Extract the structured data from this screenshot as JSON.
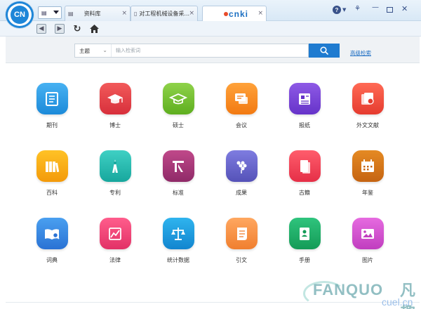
{
  "app": {
    "logo_text": "CN"
  },
  "tabs": [
    {
      "label": "资料库",
      "active": false
    },
    {
      "label": "对工程机械设备采...",
      "active": false
    },
    {
      "label": "cnki",
      "active": true
    }
  ],
  "search": {
    "field_label": "主题",
    "placeholder": "输入检索词",
    "advanced_label": "高级检索"
  },
  "colors": {
    "accent": "#1f7bd0"
  },
  "categories": [
    {
      "label": "期刊",
      "icon": "journal-icon",
      "color_top": "#47b1f2",
      "color_bottom": "#1c8ad9"
    },
    {
      "label": "博士",
      "icon": "doctor-cap-icon",
      "color_top": "#f25a5a",
      "color_bottom": "#d72f3b"
    },
    {
      "label": "硕士",
      "icon": "master-cap-icon",
      "color_top": "#8fd24a",
      "color_bottom": "#5eae1f"
    },
    {
      "label": "会议",
      "icon": "conference-icon",
      "color_top": "#ffa23a",
      "color_bottom": "#f27a12"
    },
    {
      "label": "报纸",
      "icon": "newspaper-icon",
      "color_top": "#8e5ae6",
      "color_bottom": "#6633c9"
    },
    {
      "label": "外文文献",
      "icon": "foreign-docs-icon",
      "color_top": "#ff6a55",
      "color_bottom": "#e53b2f"
    },
    {
      "label": "百科",
      "icon": "encyclopedia-icon",
      "color_top": "#ffc226",
      "color_bottom": "#f39a0a"
    },
    {
      "label": "专利",
      "icon": "patent-icon",
      "color_top": "#3fd0c4",
      "color_bottom": "#17a79d"
    },
    {
      "label": "标准",
      "icon": "standard-icon",
      "color_top": "#c0498a",
      "color_bottom": "#8f2a68"
    },
    {
      "label": "成果",
      "icon": "achievement-icon",
      "color_top": "#7e7ce0",
      "color_bottom": "#5552b8"
    },
    {
      "label": "古籍",
      "icon": "ancient-book-icon",
      "color_top": "#ff5d6c",
      "color_bottom": "#e52f47"
    },
    {
      "label": "年鉴",
      "icon": "yearbook-icon",
      "color_top": "#e58a23",
      "color_bottom": "#c56412"
    },
    {
      "label": "词典",
      "icon": "dictionary-icon",
      "color_top": "#4aa0f0",
      "color_bottom": "#2a72d4"
    },
    {
      "label": "法律",
      "icon": "law-icon",
      "color_top": "#ff5d8c",
      "color_bottom": "#e23166"
    },
    {
      "label": "统计数据",
      "icon": "statistics-icon",
      "color_top": "#2fb4ee",
      "color_bottom": "#1285cf"
    },
    {
      "label": "引文",
      "icon": "citation-icon",
      "color_top": "#ffa760",
      "color_bottom": "#f07f2f"
    },
    {
      "label": "手册",
      "icon": "handbook-icon",
      "color_top": "#2fc47d",
      "color_bottom": "#149b57"
    },
    {
      "label": "图片",
      "icon": "picture-icon",
      "color_top": "#e66be0",
      "color_bottom": "#c03dbf"
    }
  ],
  "watermark": {
    "text": "FANQUO",
    "cn": "凡趣",
    "sub": "cuel.cn"
  }
}
